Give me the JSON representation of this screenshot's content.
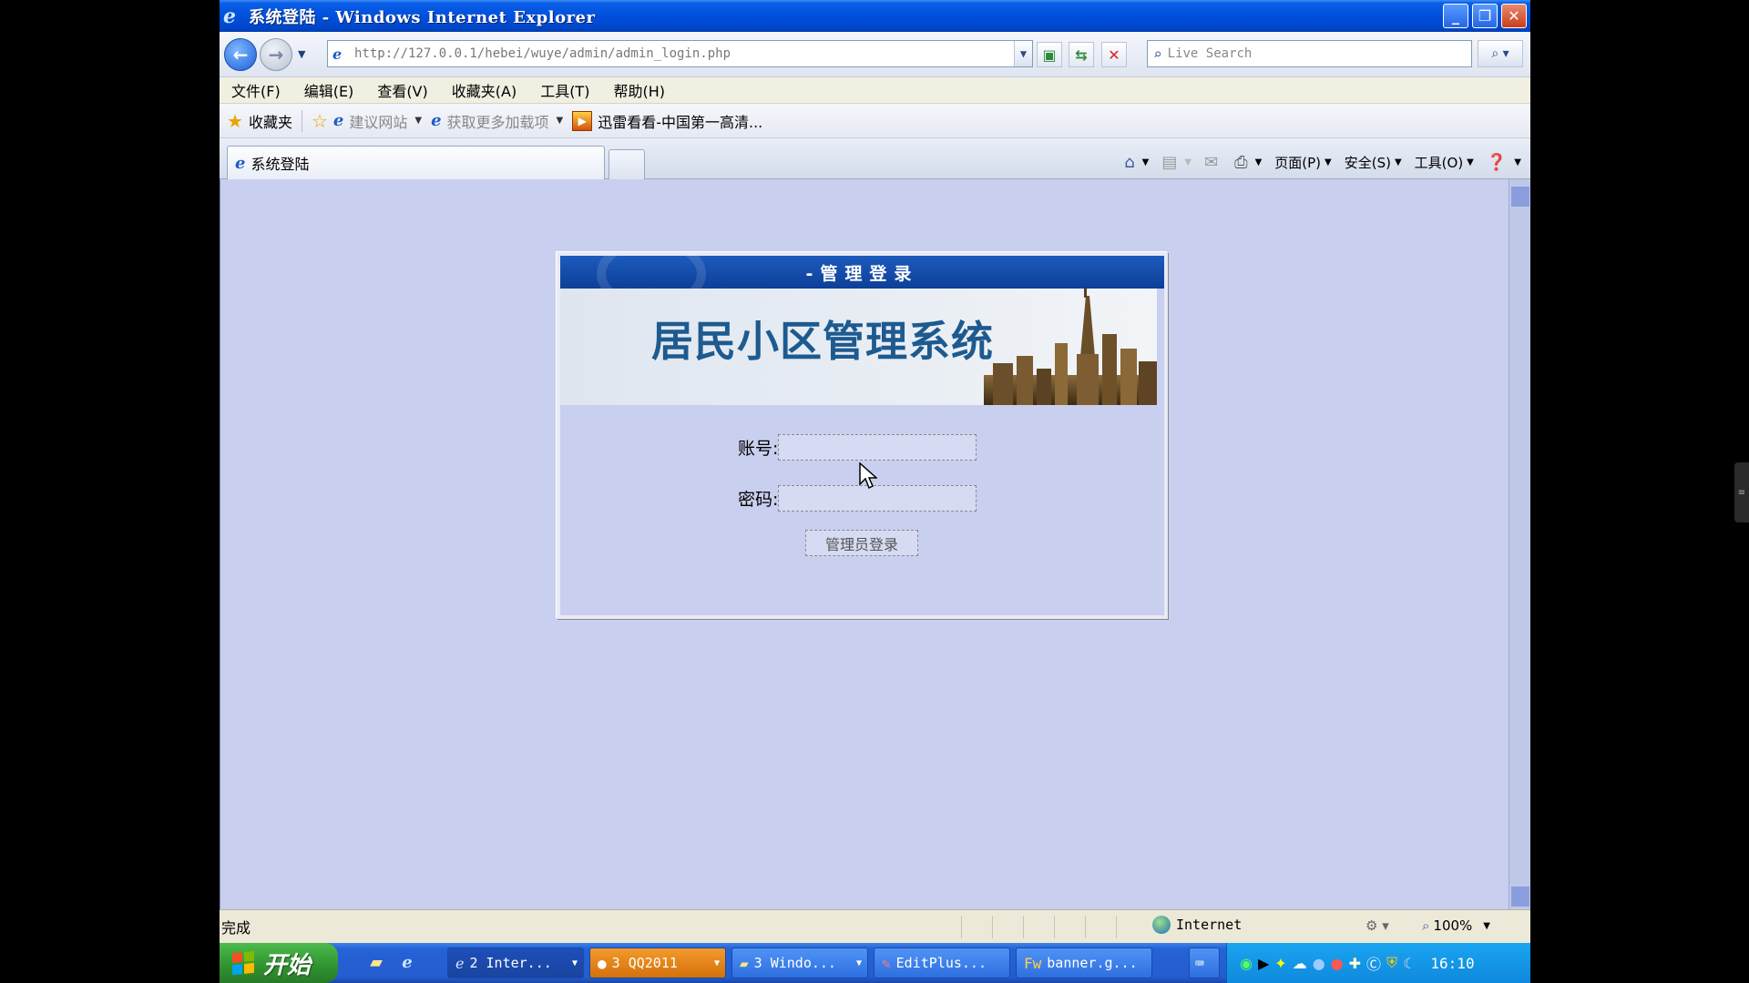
{
  "window": {
    "title": "系统登陆 - Windows Internet Explorer"
  },
  "nav": {
    "url": "http://127.0.0.1/hebei/wuye/admin/admin_login.php",
    "search_placeholder": "Live Search"
  },
  "menu": {
    "items": [
      "文件(F)",
      "编辑(E)",
      "查看(V)",
      "收藏夹(A)",
      "工具(T)",
      "帮助(H)"
    ]
  },
  "favorites": {
    "label": "收藏夹",
    "items": [
      "建议网站",
      "获取更多加载项",
      "迅雷看看-中国第一高清..."
    ]
  },
  "tab": {
    "title": "系统登陆"
  },
  "commandbar": {
    "page": "页面(P)",
    "safety": "安全(S)",
    "tools": "工具(O)"
  },
  "login": {
    "header": "-管理登录",
    "system_name": "居民小区管理系统",
    "account_label": "账号:",
    "password_label": "密码:",
    "account_value": "",
    "password_value": "",
    "submit_label": "管理员登录"
  },
  "status": {
    "text": "完成",
    "zone": "Internet",
    "zoom": "100%"
  },
  "taskbar": {
    "start_label": "开始",
    "tasks": [
      "2 Inter...",
      "3 QQ2011",
      "3 Windo...",
      "EditPlus...",
      "banner.g..."
    ],
    "clock": "16:10"
  },
  "colors": {
    "content_bg": "#c9cfee",
    "header_blue": "#1d5bbd",
    "system_name": "#1d5a8f"
  }
}
